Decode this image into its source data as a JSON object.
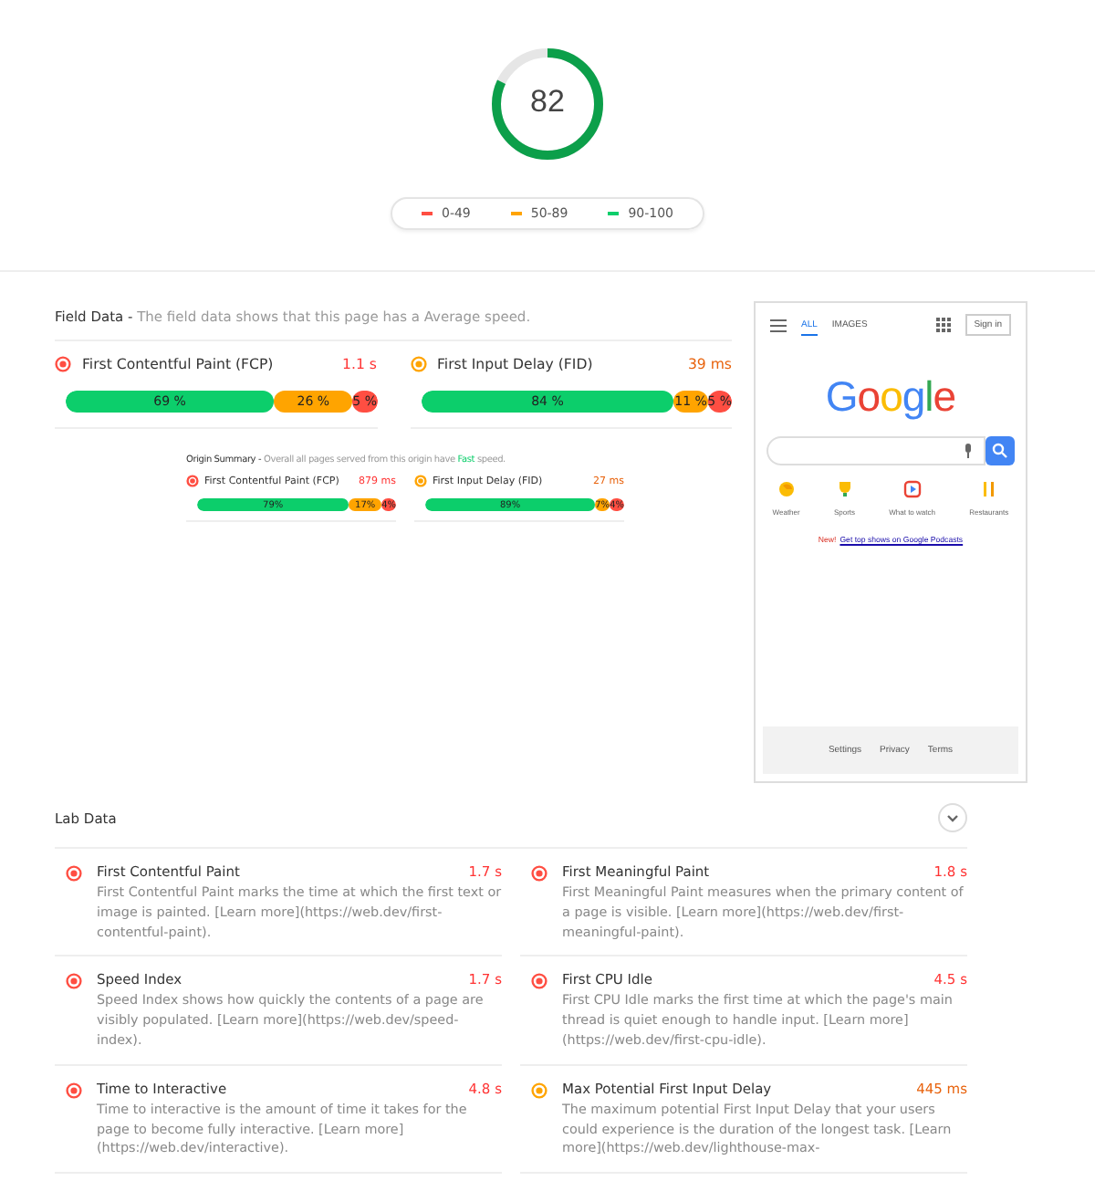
{
  "gauge": {
    "score": "82",
    "level": 0.82,
    "kind": "fast"
  },
  "legend": [
    {
      "label": "0-49",
      "kind": "slow"
    },
    {
      "label": "50-89",
      "kind": "average"
    },
    {
      "label": "90-100",
      "kind": "fast"
    }
  ],
  "field_data": {
    "title": "Field Data -",
    "description": "The field data shows that this page has a Average speed.",
    "metrics": [
      {
        "name": "First Contentful Paint (FCP)",
        "value": "1.1 s",
        "kind": "slow",
        "segments": [
          {
            "label": "69 %",
            "kind": "fast"
          },
          {
            "label": "26 %",
            "kind": "average"
          },
          {
            "label": "5 %",
            "kind": "slow"
          }
        ]
      },
      {
        "name": "First Input Delay (FID)",
        "value": "39 ms",
        "kind": "average",
        "segments": [
          {
            "label": "84 %",
            "kind": "fast"
          },
          {
            "label": "11 %",
            "kind": "average"
          },
          {
            "label": "5 %",
            "kind": "slow"
          }
        ]
      }
    ]
  },
  "origin_summary": {
    "title": "Origin Summary -",
    "description": "Overall all pages served from this origin have",
    "speed": "Fast",
    "suffix": "speed.",
    "metrics": [
      {
        "name": "First Contentful Paint (FCP)",
        "value": "879 ms",
        "kind": "slow",
        "segments": [
          {
            "label": "79%",
            "kind": "fast"
          },
          {
            "label": "17%",
            "kind": "average"
          },
          {
            "label": "4%",
            "kind": "slow"
          }
        ]
      },
      {
        "name": "First Input Delay (FID)",
        "value": "27 ms",
        "kind": "average",
        "segments": [
          {
            "label": "89%",
            "kind": "fast"
          },
          {
            "label": "7%",
            "kind": "average"
          },
          {
            "label": "4%",
            "kind": "slow"
          }
        ]
      }
    ]
  },
  "phone_screenshot": {
    "tabs": [
      {
        "label": "ALL",
        "selected": true
      },
      {
        "label": "IMAGES",
        "selected": false
      }
    ],
    "sign_in": "Sign in",
    "logo": "Google",
    "shortcuts": [
      {
        "label": "Weather",
        "kind": "weather"
      },
      {
        "label": "Sports",
        "kind": "trophy"
      },
      {
        "label": "What to watch",
        "kind": "play"
      },
      {
        "label": "Restaurants",
        "kind": "fork"
      }
    ],
    "promo_badge": "New!",
    "promo_link": "Get top shows on Google Podcasts",
    "footer": [
      "Settings",
      "Privacy",
      "Terms"
    ]
  },
  "lab_data": {
    "title": "Lab Data",
    "audits": [
      {
        "name": "First Contentful Paint",
        "value": "1.7 s",
        "kind": "slow",
        "description": "First Contentful Paint marks the time at which the first text or image is painted. [Learn more](https://web.dev/first-contentful-paint)."
      },
      {
        "name": "First Meaningful Paint",
        "value": "1.8 s",
        "kind": "slow",
        "description": "First Meaningful Paint measures when the primary content of a page is visible. [Learn more](https://web.dev/first-meaningful-paint)."
      },
      {
        "name": "Speed Index",
        "value": "1.7 s",
        "kind": "slow",
        "description": "Speed Index shows how quickly the contents of a page are visibly populated. [Learn more](https://web.dev/speed-index)."
      },
      {
        "name": "First CPU Idle",
        "value": "4.5 s",
        "kind": "slow",
        "description": "First CPU Idle marks the first time at which the page's main thread is quiet enough to handle input. [Learn more](https://web.dev/first-cpu-idle)."
      },
      {
        "name": "Time to Interactive",
        "value": "4.8 s",
        "kind": "slow",
        "description": "Time to interactive is the amount of time it takes for the page to become fully interactive. [Learn more](https://web.dev/interactive)."
      },
      {
        "name": "Max Potential First Input Delay",
        "value": "445 ms",
        "kind": "average",
        "description": "The maximum potential First Input Delay that your users could experience is the duration of the longest task. [Learn more](https://web.dev/lighthouse-max-"
      }
    ]
  }
}
